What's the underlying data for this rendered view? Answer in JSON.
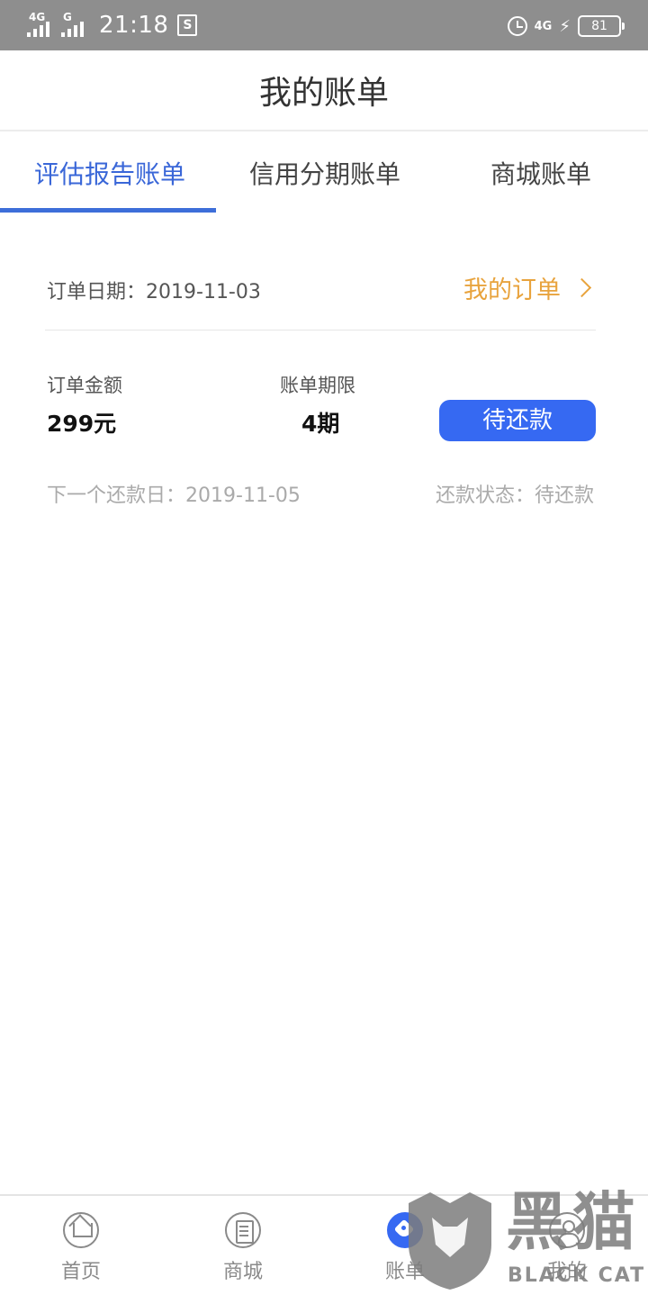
{
  "status_bar": {
    "network_1": "4G",
    "network_2": "G",
    "time": "21:18",
    "s_icon": "S",
    "right_network": "4G",
    "battery": "81"
  },
  "header": {
    "title": "我的账单"
  },
  "tabs": [
    {
      "label": "评估报告账单",
      "active": true
    },
    {
      "label": "信用分期账单",
      "active": false
    },
    {
      "label": "商城账单",
      "active": false
    }
  ],
  "order": {
    "date_label": "订单日期：",
    "date": "2019-11-03",
    "my_order_link": "我的订单",
    "amount_label": "订单金额",
    "amount_value": "299元",
    "term_label": "账单期限",
    "term_value": "4期",
    "action_button": "待还款",
    "next_due_label": "下一个还款日：",
    "next_due_date": "2019-11-05",
    "status_label": "还款状态：",
    "status_value": "待还款"
  },
  "bottom_nav": [
    {
      "label": "首页",
      "icon": "home-icon"
    },
    {
      "label": "商城",
      "icon": "mall-icon"
    },
    {
      "label": "账单",
      "icon": "tag-icon",
      "active": true
    },
    {
      "label": "我的",
      "icon": "profile-icon"
    }
  ],
  "watermark": {
    "cn": "黑猫",
    "en": "BLACK CAT"
  },
  "colors": {
    "accent_blue": "#3669f2",
    "tab_active": "#3a67d8",
    "link_orange": "#e8a33d",
    "status_bar": "#8e8e8e"
  }
}
